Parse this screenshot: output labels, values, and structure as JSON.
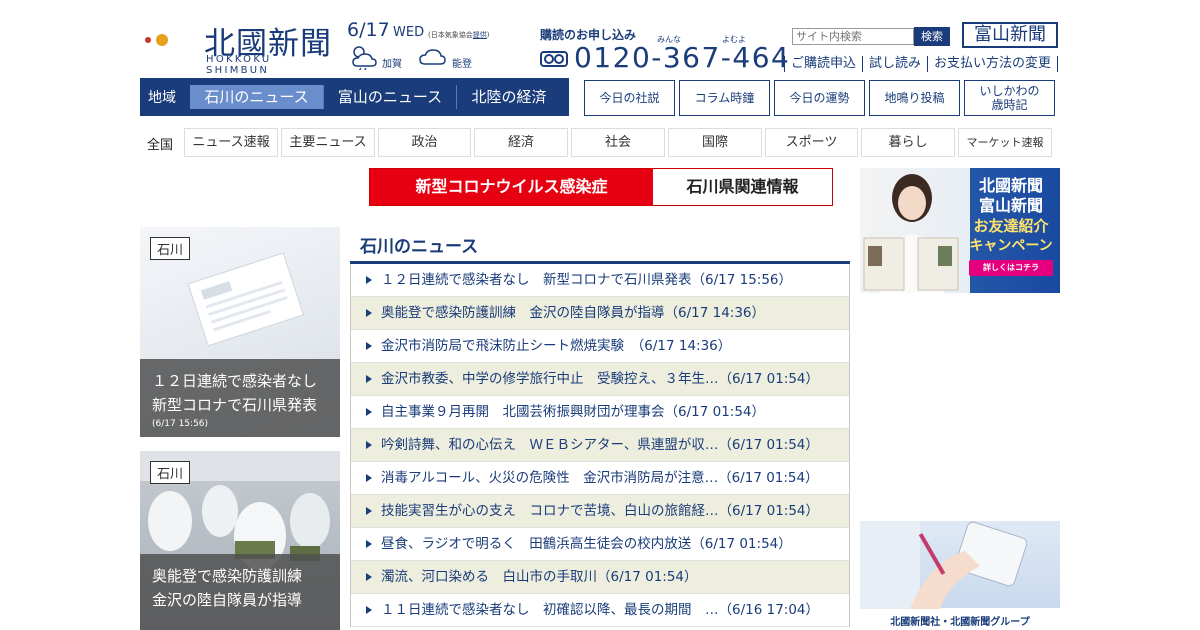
{
  "header": {
    "logo_text": "北國新聞",
    "logo_sub": "HOKKOKU SHIMBUN",
    "toyama_logo": "富山新聞"
  },
  "weather": {
    "date": "6/17",
    "weekday": "WED",
    "note_prefix": "(日本気象協会",
    "note_link": "提供",
    "note_suffix": ")",
    "places": [
      {
        "name": "加賀",
        "icon": "sun-cloud-icon"
      },
      {
        "name": "能登",
        "icon": "cloud-icon"
      }
    ]
  },
  "subscription": {
    "title": "購読のお申し込み",
    "ruby1": "みんな",
    "ruby2": "よむよ",
    "phone": "0120-367-464",
    "links": [
      "ご購読申込",
      "試し読み",
      "お支払い方法の変更"
    ]
  },
  "search": {
    "placeholder": "サイト内検索",
    "button": "検索"
  },
  "region_nav": {
    "label": "地域",
    "tabs": [
      "石川のニュース",
      "富山のニュース",
      "北陸の経済"
    ]
  },
  "box_buttons": [
    "今日の社説",
    "コラム時鐘",
    "今日の運勢",
    "地鳴り投稿",
    "いしかわの\n歳時記"
  ],
  "categories": {
    "label": "全国",
    "items": [
      "ニュース速報",
      "主要ニュース",
      "政治",
      "経済",
      "社会",
      "国際",
      "スポーツ",
      "暮らし",
      "マーケット速報"
    ]
  },
  "corona_banner": {
    "left": "新型コロナウイルス感染症",
    "right": "石川県関連情報"
  },
  "cards": [
    {
      "tag": "石川",
      "title": "１２日連続で感染者なし　新型コロナで石川県発表",
      "date": "(6/17 15:56)"
    },
    {
      "tag": "石川",
      "title": "奥能登で感染防護訓練　金沢の陸自隊員が指導",
      "date": ""
    }
  ],
  "news_list": {
    "title": "石川のニュース",
    "items": [
      "１２日連続で感染者なし　新型コロナで石川県発表（6/17 15:56）",
      "奥能登で感染防護訓練　金沢の陸自隊員が指導（6/17 14:36）",
      "金沢市消防局で飛沫防止シート燃焼実験　（6/17 14:36）",
      "金沢市教委、中学の修学旅行中止　受験控え、３年生…（6/17 01:54）",
      "自主事業９月再開　北國芸術振興財団が理事会（6/17 01:54）",
      "吟剣詩舞、和の心伝え　ＷＥＢシアター、県連盟が収…（6/17 01:54）",
      "消毒アルコール、火災の危険性　金沢市消防局が注意…（6/17 01:54）",
      "技能実習生が心の支え　コロナで苦境、白山の旅館経…（6/17 01:54）",
      "昼食、ラジオで明るく　田鶴浜高生徒会の校内放送（6/17 01:54）",
      "濁流、河口染める　白山市の手取川（6/17 01:54）",
      "１１日連続で感染者なし　初確認以降、最長の期間　…（6/16 17:04）"
    ]
  },
  "ads": {
    "ad1_lines": [
      "北國新聞",
      "富山新聞",
      "お友達紹介",
      "キャンペーン"
    ],
    "ad1_button": "詳しくはコチラ",
    "ad2_caption": "北國新聞社・北國新聞グループ"
  }
}
